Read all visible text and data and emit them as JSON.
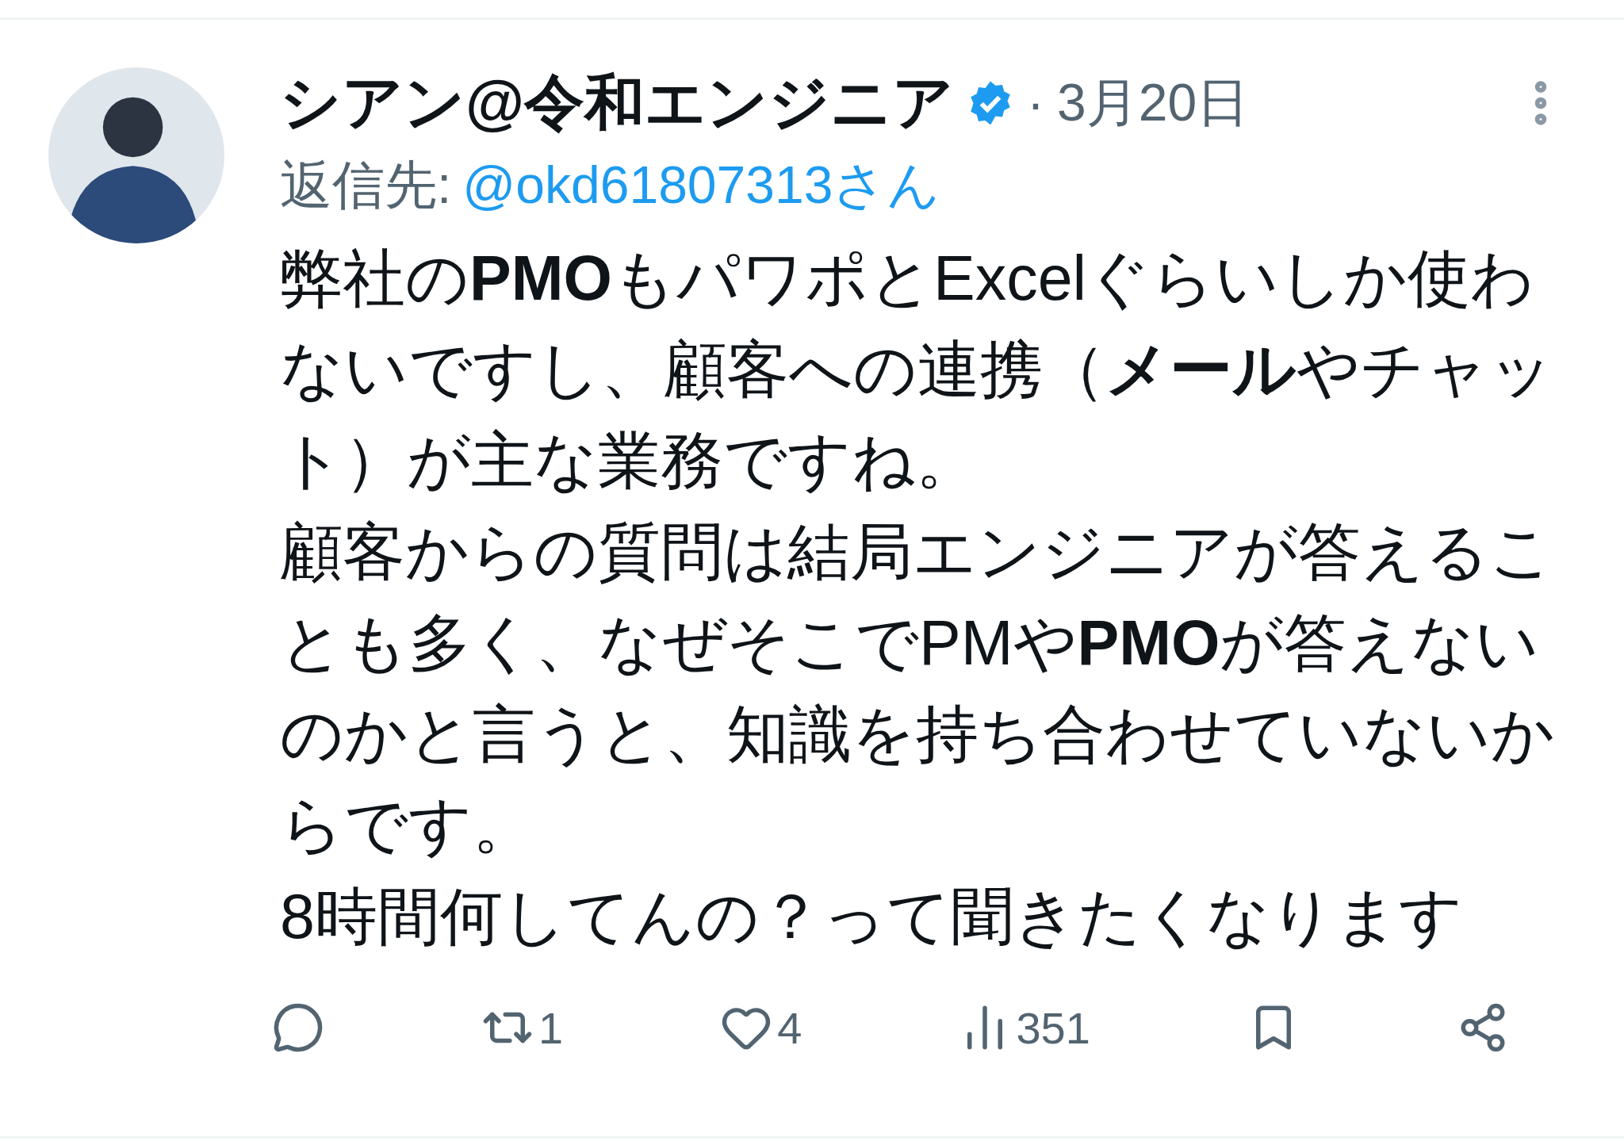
{
  "tweet": {
    "author_name": "シアン@令和エンジニア",
    "verified": true,
    "separator": "·",
    "date": "3月20日",
    "reply_label": "返信先:",
    "reply_to": "@okd61807313さん",
    "paragraphs": [
      "弊社の**PMO**もパワポとExcelぐらいしか使わないですし、顧客への連携（**メール**やチャット）が主な業務ですね。",
      "顧客からの質問は結局エンジニアが答えることも多く、なぜそこでPMや**PMO**が答えないのかと言うと、知識を持ち合わせていないからです。",
      "8時間何してんの？って聞きたくなります"
    ],
    "actions": [
      {
        "kind": "reply"
      },
      {
        "kind": "repost",
        "count": "1"
      },
      {
        "kind": "like",
        "count": "4"
      },
      {
        "kind": "views",
        "count": "351"
      },
      {
        "kind": "bookmark"
      },
      {
        "kind": "share"
      }
    ]
  }
}
